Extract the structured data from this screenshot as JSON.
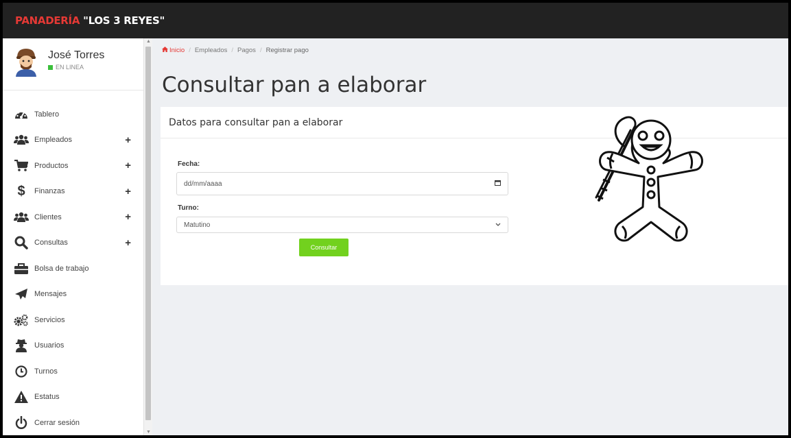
{
  "app": {
    "brand_prefix": "PANADERÍA",
    "brand_name": "\"LOS 3 REYES\"",
    "accent": "#e53935"
  },
  "user": {
    "name": "José Torres",
    "status": "EN LINEA"
  },
  "sidebar": {
    "items": [
      {
        "label": "Tablero",
        "icon": "dashboard-icon",
        "expandable": false
      },
      {
        "label": "Empleados",
        "icon": "users-icon",
        "expandable": true
      },
      {
        "label": "Productos",
        "icon": "cart-icon",
        "expandable": true
      },
      {
        "label": "Finanzas",
        "icon": "dollar-icon",
        "expandable": true
      },
      {
        "label": "Clientes",
        "icon": "users-icon",
        "expandable": true
      },
      {
        "label": "Consultas",
        "icon": "search-icon",
        "expandable": true
      },
      {
        "label": "Bolsa de trabajo",
        "icon": "briefcase-icon",
        "expandable": false
      },
      {
        "label": "Mensajes",
        "icon": "paper-plane-icon",
        "expandable": false
      },
      {
        "label": "Servicios",
        "icon": "gears-icon",
        "expandable": false
      },
      {
        "label": "Usuarios",
        "icon": "user-secret-icon",
        "expandable": false
      },
      {
        "label": "Turnos",
        "icon": "clock-icon",
        "expandable": false
      },
      {
        "label": "Estatus",
        "icon": "warning-icon",
        "expandable": false
      },
      {
        "label": "Cerrar sesión",
        "icon": "power-icon",
        "expandable": false
      }
    ],
    "plus": "+"
  },
  "breadcrumb": {
    "home": "Inicio",
    "items": [
      "Empleados",
      "Pagos",
      "Registrar pago"
    ],
    "separator": "/"
  },
  "page": {
    "title": "Consultar pan a elaborar"
  },
  "form": {
    "card_title": "Datos para consultar pan a elaborar",
    "date_label": "Fecha:",
    "date_placeholder": "dd/mm/aaaa",
    "shift_label": "Turno:",
    "shift_value": "Matutino",
    "submit_label": "Consultar",
    "submit_color": "#72d11e"
  },
  "illustration": {
    "icon": "gingerbread-man-icon"
  }
}
